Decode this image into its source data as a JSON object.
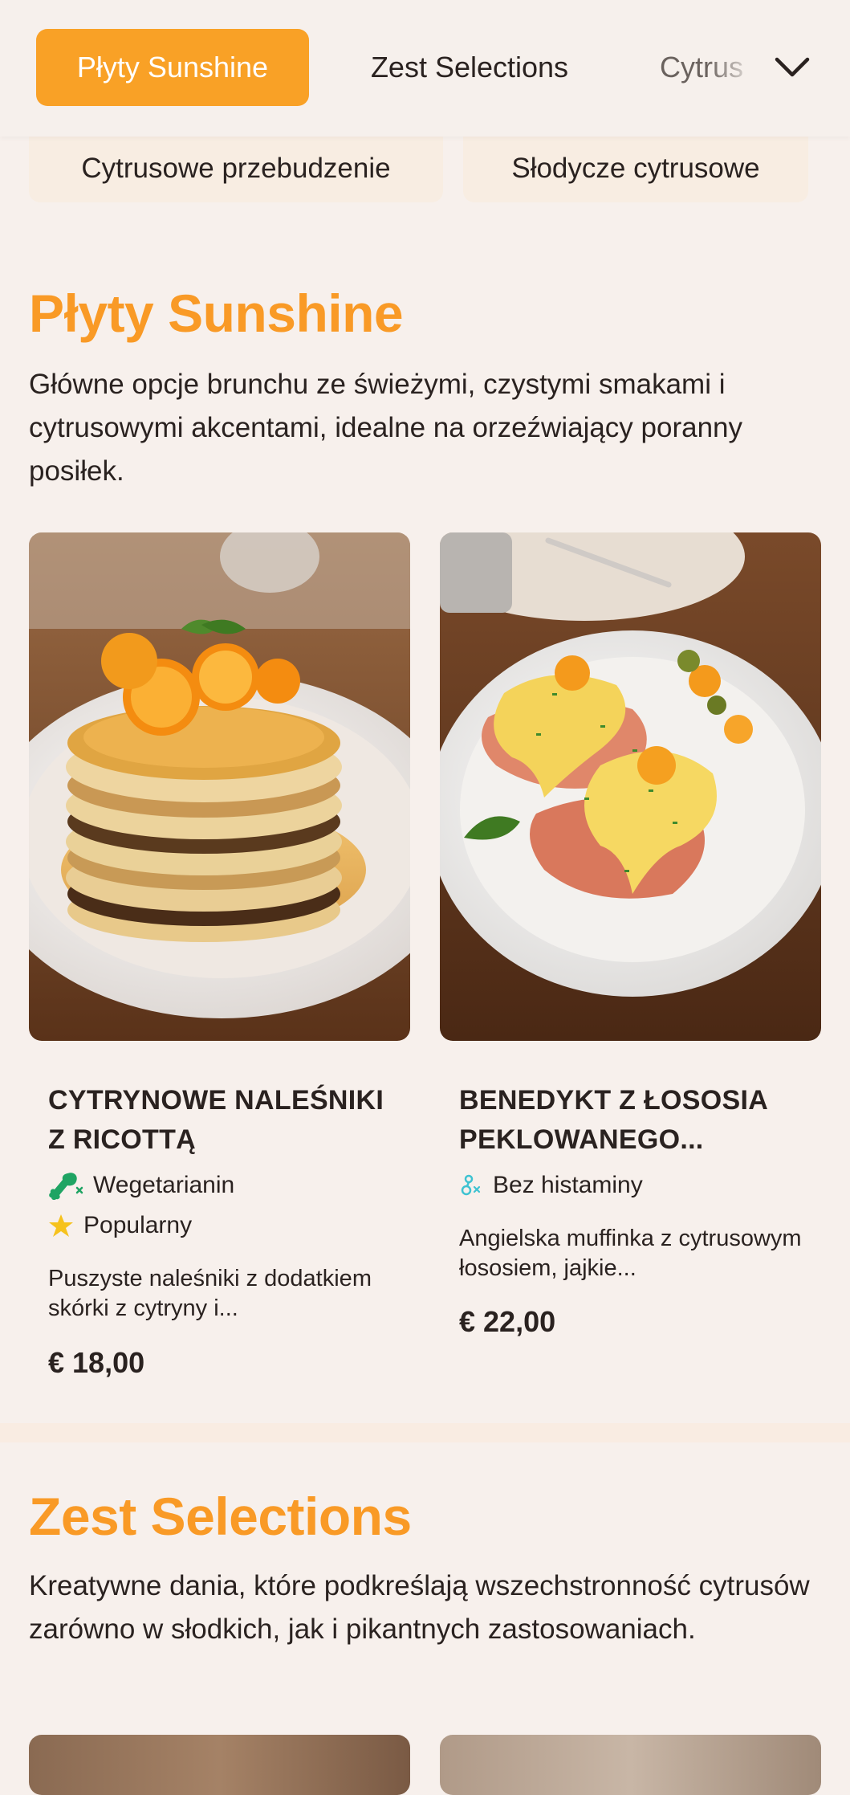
{
  "nav": {
    "tabs": [
      {
        "label": "Płyty Sunshine",
        "active": true
      },
      {
        "label": "Zest Selections",
        "active": false
      },
      {
        "label": "Cytrus",
        "active": false
      }
    ],
    "more_icon": "chevron-down-icon"
  },
  "subcategories": [
    "Cytrusowe przebudzenie",
    "Słodycze cytrusowe"
  ],
  "sections": [
    {
      "title": "Płyty Sunshine",
      "description": "Główne opcje brunchu ze świeżymi, czystymi smakami i cytrusowymi akcentami, idealne na orzeźwiający poranny posiłek.",
      "items": [
        {
          "name": "CYTRYNOWE NALEŚNIKI Z RICOTTĄ",
          "tags": [
            {
              "label": "Wegetarianin",
              "icon": "vegetarian-leg-icon",
              "color": "#1fa463"
            },
            {
              "label": "Popularny",
              "icon": "star-icon",
              "color": "#f6c21d"
            }
          ],
          "description": "Puszyste naleśniki z dodatkiem skórki z cytryny i...",
          "price": "€ 18,00"
        },
        {
          "name": "BENEDYKT Z ŁOSOSIA PEKLOWANEGO...",
          "tags": [
            {
              "label": "Bez histaminy",
              "icon": "histamine-free-icon",
              "color": "#3ec2d1"
            }
          ],
          "description": "Angielska muffinka z cytrusowym łososiem, jajkie...",
          "price": "€ 22,00"
        }
      ]
    },
    {
      "title": "Zest Selections",
      "description": "Kreatywne dania, które podkreślają wszechstronność cytrusów zarówno w słodkich, jak i pikantnych zastosowaniach."
    }
  ],
  "colors": {
    "accent": "#f9a126",
    "background": "#f7f0ec",
    "chip": "#f8ede2",
    "text": "#2a2220"
  }
}
